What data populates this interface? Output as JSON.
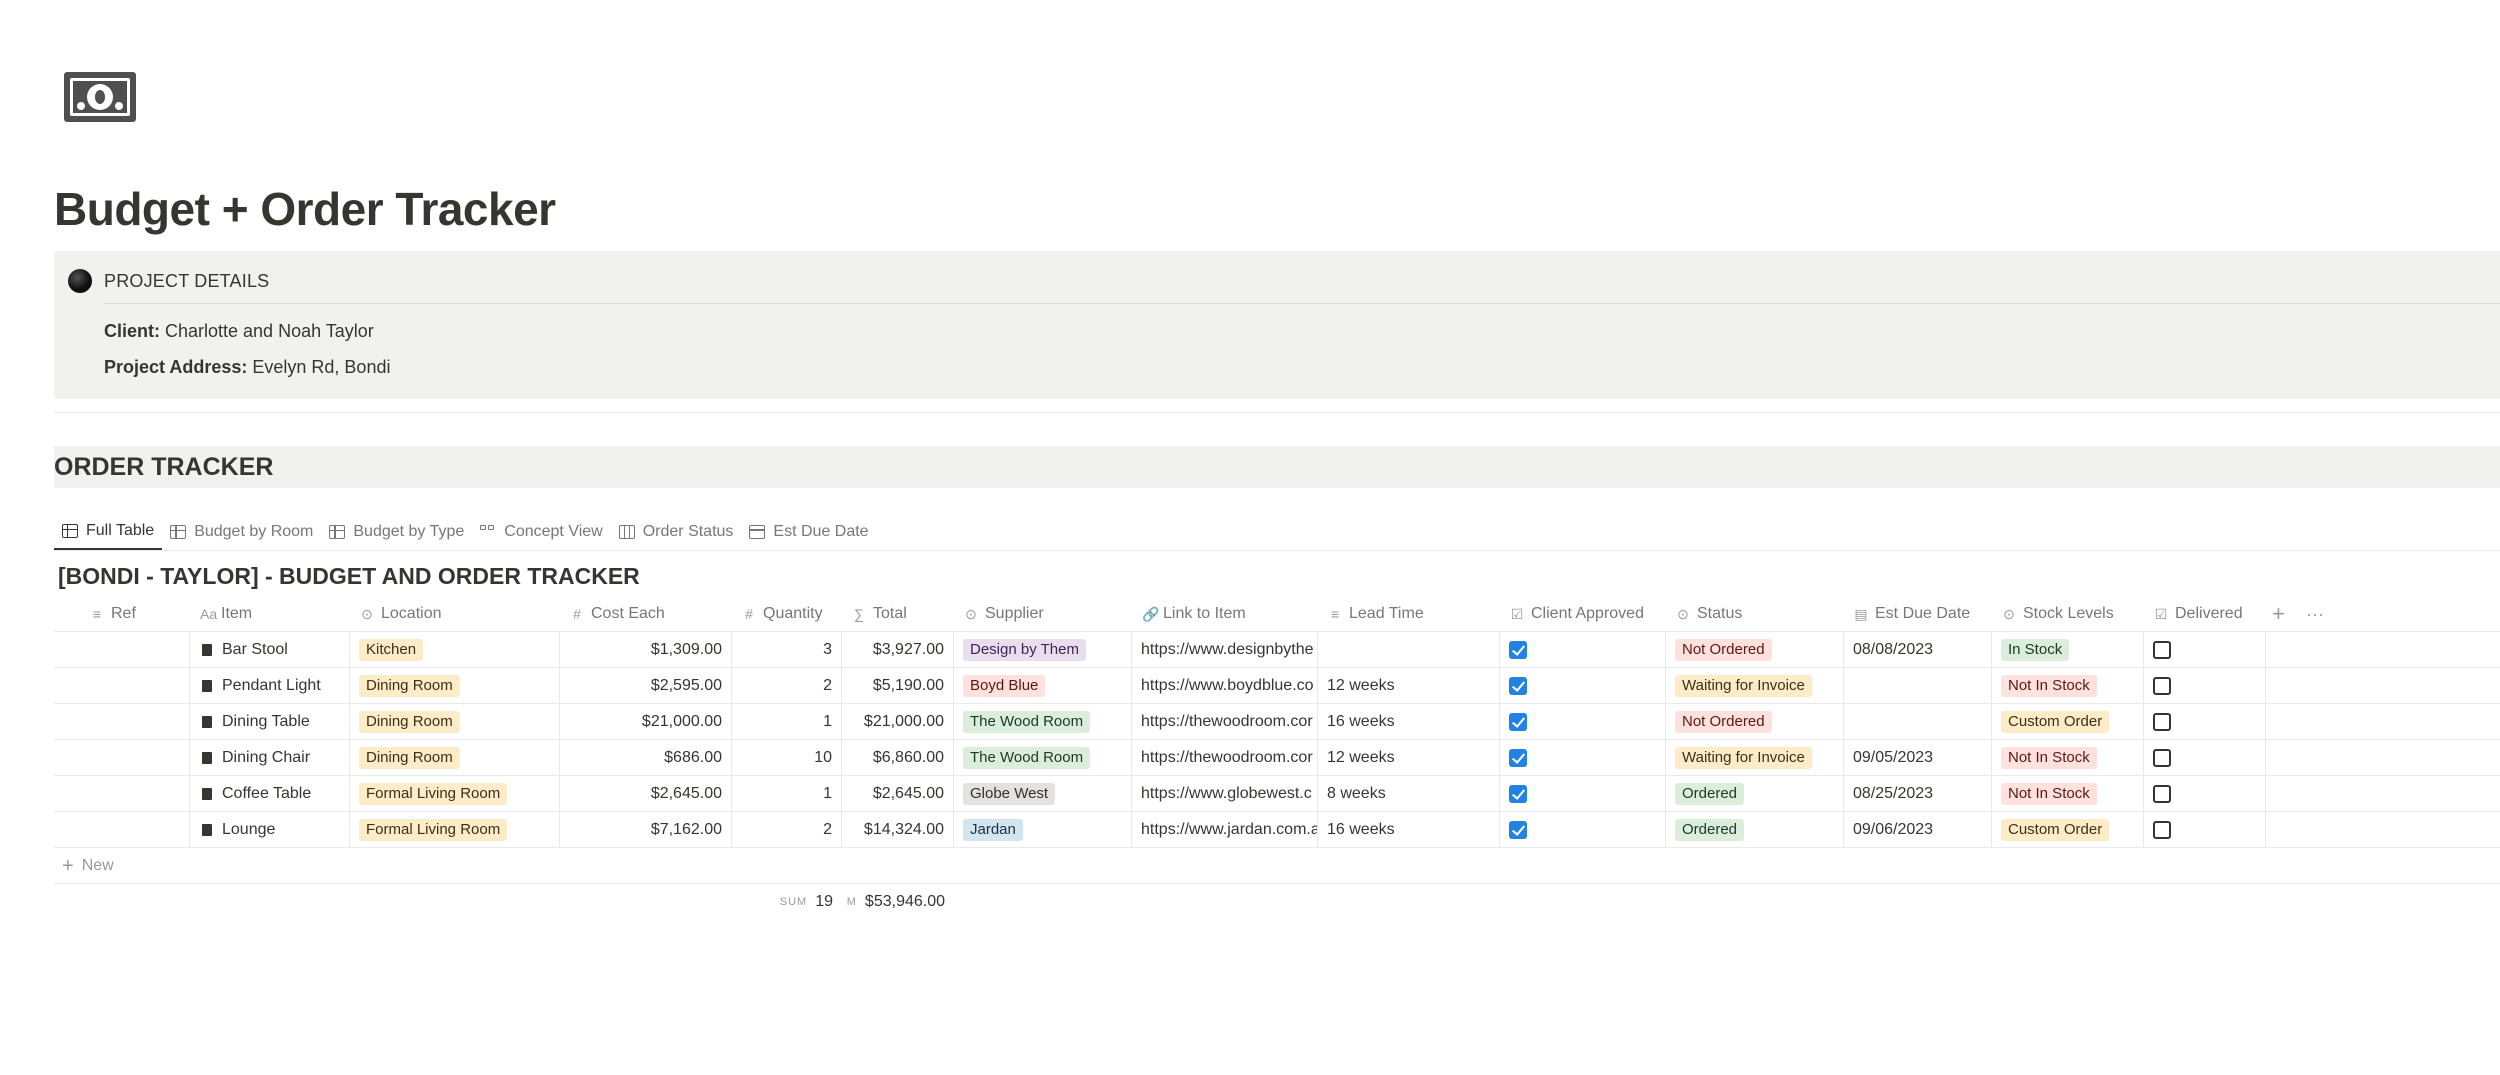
{
  "page": {
    "icon": "banknote-icon",
    "title": "Budget + Order Tracker"
  },
  "callout": {
    "icon": "black-circle-icon",
    "heading": "PROJECT DETAILS",
    "client_label": "Client:",
    "client_value": " Charlotte and Noah Taylor",
    "address_label": "Project Address:",
    "address_value": " Evelyn Rd, Bondi"
  },
  "section_heading": "ORDER TRACKER",
  "tabs": [
    {
      "label": "Full Table",
      "icon": "table-icon",
      "active": true
    },
    {
      "label": "Budget by Room",
      "icon": "table-icon",
      "active": false
    },
    {
      "label": "Budget by Type",
      "icon": "table-icon",
      "active": false
    },
    {
      "label": "Concept View",
      "icon": "gallery-icon",
      "active": false
    },
    {
      "label": "Order Status",
      "icon": "board-icon",
      "active": false
    },
    {
      "label": "Est Due Date",
      "icon": "calendar-icon",
      "active": false
    }
  ],
  "database_title": "[BONDI - TAYLOR] - BUDGET AND ORDER TRACKER",
  "columns": [
    {
      "label": "Ref",
      "icon": "≡"
    },
    {
      "label": "Item",
      "icon": "Aa"
    },
    {
      "label": "Location",
      "icon": "⊙"
    },
    {
      "label": "Cost Each",
      "icon": "#"
    },
    {
      "label": "Quantity",
      "icon": "#"
    },
    {
      "label": "Total",
      "icon": "∑"
    },
    {
      "label": "Supplier",
      "icon": "⊙"
    },
    {
      "label": "Link to Item",
      "icon": "🔗"
    },
    {
      "label": "Lead Time",
      "icon": "≡"
    },
    {
      "label": "Client Approved",
      "icon": "☑"
    },
    {
      "label": "Status",
      "icon": "⊙"
    },
    {
      "label": "Est Due Date",
      "icon": "▤"
    },
    {
      "label": "Stock Levels",
      "icon": "⊙"
    },
    {
      "label": "Delivered",
      "icon": "☑"
    }
  ],
  "colors": {
    "kitchen": {
      "bg": "#fdecc8",
      "fg": "#402c1b"
    },
    "dining": {
      "bg": "#fdecc8",
      "fg": "#402c1b"
    },
    "formal": {
      "bg": "#fdecc8",
      "fg": "#402c1b"
    },
    "purple": {
      "bg": "#e8deee",
      "fg": "#412454"
    },
    "red": {
      "bg": "#ffe2dd",
      "fg": "#5d1715"
    },
    "green": {
      "bg": "#dbeddb",
      "fg": "#1c3829"
    },
    "gray": {
      "bg": "#e3e2e0",
      "fg": "#32302c"
    },
    "blue": {
      "bg": "#d3e5ef",
      "fg": "#183347"
    },
    "yellow": {
      "bg": "#fdecc8",
      "fg": "#402c1b"
    },
    "check_blue": "#2383e2"
  },
  "rows": [
    {
      "ref": "",
      "item": "Bar Stool",
      "location": "Kitchen",
      "location_color": "kitchen",
      "cost_each": "$1,309.00",
      "quantity": "3",
      "total": "$3,927.00",
      "supplier": "Design by Them",
      "supplier_color": "purple",
      "link": "https://www.designbythe",
      "lead_time": "",
      "client_approved": true,
      "status": "Not Ordered",
      "status_color": "red",
      "est_due_date": "08/08/2023",
      "stock": "In Stock",
      "stock_color": "green",
      "delivered": false
    },
    {
      "ref": "",
      "item": "Pendant Light",
      "location": "Dining Room",
      "location_color": "dining",
      "cost_each": "$2,595.00",
      "quantity": "2",
      "total": "$5,190.00",
      "supplier": "Boyd Blue",
      "supplier_color": "red",
      "link": "https://www.boydblue.co",
      "lead_time": "12 weeks",
      "client_approved": true,
      "status": "Waiting for Invoice",
      "status_color": "yellow",
      "est_due_date": "",
      "stock": "Not In Stock",
      "stock_color": "red",
      "delivered": false
    },
    {
      "ref": "",
      "item": "Dining Table",
      "location": "Dining Room",
      "location_color": "dining",
      "cost_each": "$21,000.00",
      "quantity": "1",
      "total": "$21,000.00",
      "supplier": "The Wood Room",
      "supplier_color": "green",
      "link": "https://thewoodroom.cor",
      "lead_time": "16 weeks",
      "client_approved": true,
      "status": "Not Ordered",
      "status_color": "red",
      "est_due_date": "",
      "stock": "Custom Order",
      "stock_color": "yellow",
      "delivered": false
    },
    {
      "ref": "",
      "item": "Dining Chair",
      "location": "Dining Room",
      "location_color": "dining",
      "cost_each": "$686.00",
      "quantity": "10",
      "total": "$6,860.00",
      "supplier": "The Wood Room",
      "supplier_color": "green",
      "link": "https://thewoodroom.cor",
      "lead_time": "12 weeks",
      "client_approved": true,
      "status": "Waiting for Invoice",
      "status_color": "yellow",
      "est_due_date": "09/05/2023",
      "stock": "Not In Stock",
      "stock_color": "red",
      "delivered": false
    },
    {
      "ref": "",
      "item": "Coffee Table",
      "location": "Formal Living Room",
      "location_color": "formal",
      "cost_each": "$2,645.00",
      "quantity": "1",
      "total": "$2,645.00",
      "supplier": "Globe West",
      "supplier_color": "gray",
      "link": "https://www.globewest.c",
      "lead_time": "8 weeks",
      "client_approved": true,
      "status": "Ordered",
      "status_color": "green",
      "est_due_date": "08/25/2023",
      "stock": "Not In Stock",
      "stock_color": "red",
      "delivered": false
    },
    {
      "ref": "",
      "item": "Lounge",
      "location": "Formal Living Room",
      "location_color": "formal",
      "cost_each": "$7,162.00",
      "quantity": "2",
      "total": "$14,324.00",
      "supplier": "Jardan",
      "supplier_color": "blue",
      "link": "https://www.jardan.com.a",
      "lead_time": "16 weeks",
      "client_approved": true,
      "status": "Ordered",
      "status_color": "green",
      "est_due_date": "09/06/2023",
      "stock": "Custom Order",
      "stock_color": "yellow",
      "delivered": false
    }
  ],
  "new_row_label": "New",
  "summary": {
    "quantity_label": "SUM",
    "quantity_value": "19",
    "total_label": "M",
    "total_value": "$53,946.00"
  },
  "add_column_icon": "+",
  "more_icon": "···"
}
